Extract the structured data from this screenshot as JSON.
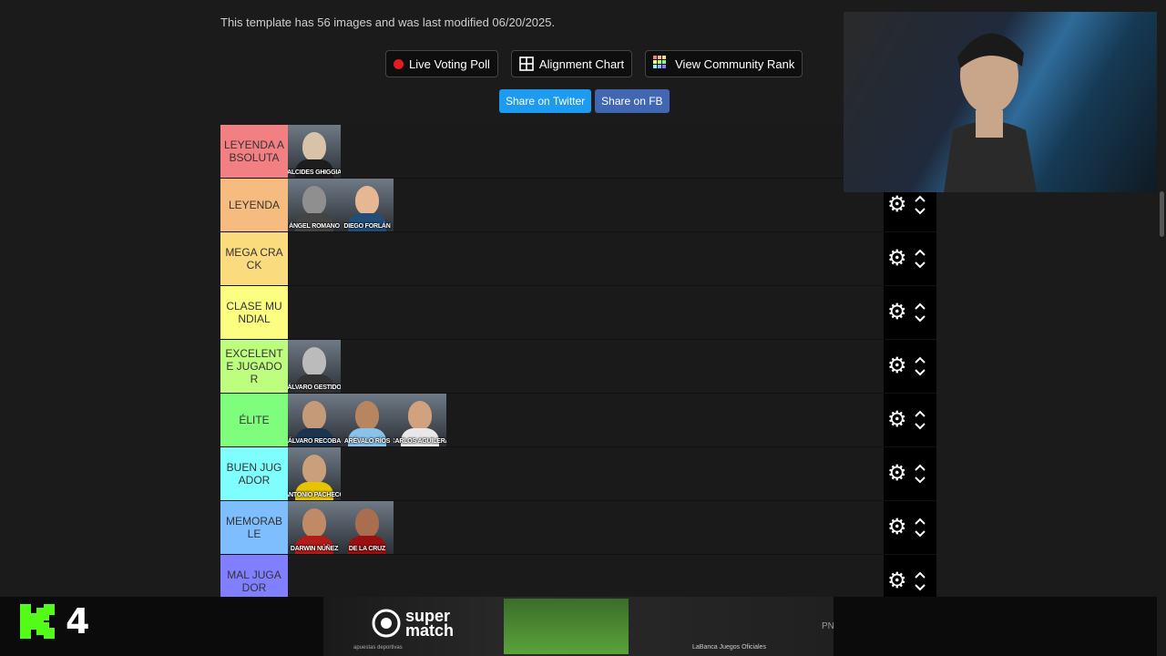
{
  "template_info": "This template has 56 images and was last modified 06/20/2025.",
  "buttons": {
    "live_voting": "Live Voting Poll",
    "alignment": "Alignment Chart",
    "community": "View Community Rank"
  },
  "share": {
    "twitter": "Share on Twitter",
    "fb": "Share on FB"
  },
  "tiers": [
    {
      "label": "LEYENDA ABSOLUTA",
      "color": "#f27f81",
      "players": [
        "ALCIDES GHIGGIA"
      ]
    },
    {
      "label": "LEYENDA",
      "color": "#f6bb7f",
      "players": [
        "ÁNGEL ROMANO",
        "DIEGO FORLÁN"
      ]
    },
    {
      "label": "MEGA CRACK",
      "color": "#fadc7e",
      "players": []
    },
    {
      "label": "CLASE MUNDIAL",
      "color": "#fbfe80",
      "players": []
    },
    {
      "label": "EXCELENTE JUGADOR",
      "color": "#bdfe7f",
      "players": [
        "ÁLVARO GESTIDO"
      ]
    },
    {
      "label": "ÉLITE",
      "color": "#7ffe7e",
      "players": [
        "ÁLVARO RECOBA",
        "ARÉVALO RÍOS",
        "CARLOS AGUILERA"
      ]
    },
    {
      "label": "BUEN JUGADOR",
      "color": "#7ffefe",
      "players": [
        "ANTONIO PACHECO"
      ]
    },
    {
      "label": "MEMORABLE",
      "color": "#7fbefe",
      "players": [
        "DARWIN NÚÑEZ",
        "DE LA CRUZ"
      ]
    },
    {
      "label": "MAL JUGADOR",
      "color": "#807fff",
      "players": []
    }
  ],
  "overlay": {
    "channel_number": "4"
  },
  "ad": {
    "brand_line1": "super",
    "brand_line2": "match",
    "sub": "apuestas deportivas",
    "fine": "LaBanca Juegos Oficiales",
    "pn": "PN"
  },
  "colors": {
    "twitter": "#1d9bf0",
    "facebook": "#4267b2",
    "kick_green": "#53fc18"
  }
}
